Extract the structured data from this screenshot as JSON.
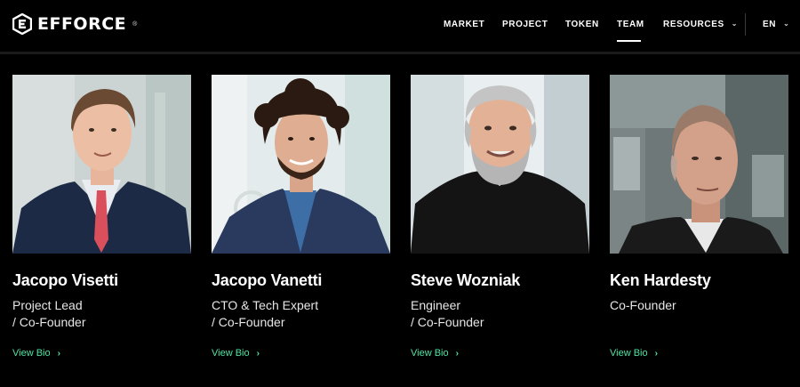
{
  "brand": {
    "name": "EFFORCE",
    "reg": "®"
  },
  "nav": {
    "items": [
      {
        "label": "MARKET"
      },
      {
        "label": "PROJECT"
      },
      {
        "label": "TOKEN"
      },
      {
        "label": "TEAM",
        "active": true
      },
      {
        "label": "RESOURCES",
        "dropdown": true
      }
    ],
    "language": "EN"
  },
  "team": [
    {
      "name": "Jacopo Visetti",
      "role_line1": "Project Lead",
      "role_line2": "/ Co-Founder",
      "link": "View Bio"
    },
    {
      "name": "Jacopo Vanetti",
      "role_line1": "CTO & Tech Expert",
      "role_line2": "/ Co-Founder",
      "link": "View Bio"
    },
    {
      "name": "Steve Wozniak",
      "role_line1": "Engineer",
      "role_line2": "/ Co-Founder",
      "link": "View Bio"
    },
    {
      "name": "Ken Hardesty",
      "role_line1": "Co-Founder",
      "role_line2": "",
      "link": "View Bio"
    }
  ],
  "colors": {
    "background": "#000000",
    "accent": "#4fe3a3",
    "text": "#ffffff"
  },
  "icons": {
    "logo": "efforce-hex-logo-icon",
    "dropdown": "chevron-down-icon",
    "link": "chevron-right-icon"
  }
}
